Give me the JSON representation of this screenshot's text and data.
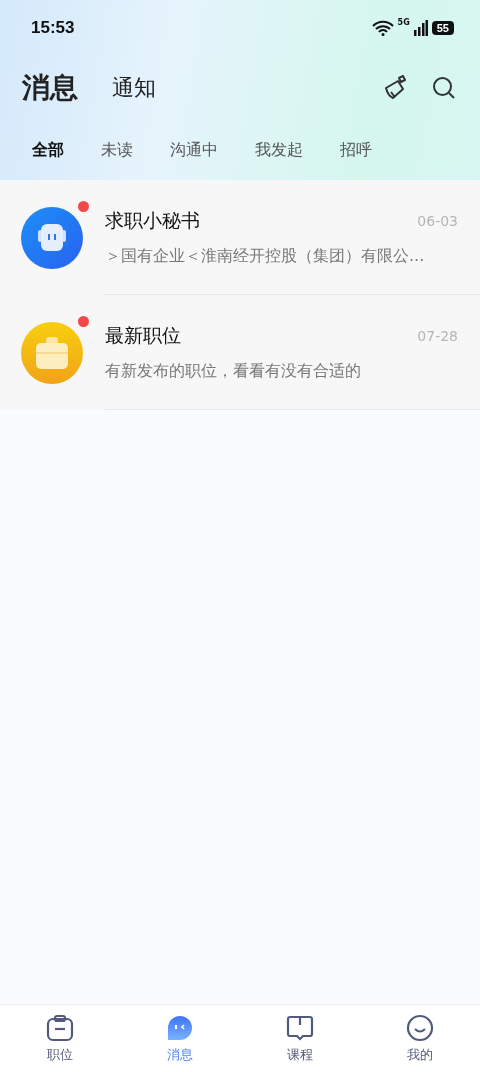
{
  "status_bar": {
    "time": "15:53",
    "network": "5G",
    "battery": "55"
  },
  "header_tabs": [
    {
      "label": "消息",
      "selected": true
    },
    {
      "label": "通知",
      "selected": false
    }
  ],
  "filter_tabs": [
    {
      "label": "全部",
      "selected": true
    },
    {
      "label": "未读",
      "selected": false
    },
    {
      "label": "沟通中",
      "selected": false
    },
    {
      "label": "我发起",
      "selected": false
    },
    {
      "label": "招呼",
      "selected": false
    }
  ],
  "messages": [
    {
      "kind": "robot",
      "title": "求职小秘书",
      "date": "06-03",
      "preview": "＞国有企业＜淮南经开控股（集团）有限公...",
      "unread": true
    },
    {
      "kind": "briefcase",
      "title": "最新职位",
      "date": "07-28",
      "preview": "有新发布的职位，看看有没有合适的",
      "unread": true
    }
  ],
  "bottom_nav": [
    {
      "kind": "jobs",
      "label": "职位",
      "selected": false
    },
    {
      "kind": "messages",
      "label": "消息",
      "selected": true
    },
    {
      "kind": "courses",
      "label": "课程",
      "selected": false
    },
    {
      "kind": "me",
      "label": "我的",
      "selected": false
    }
  ]
}
